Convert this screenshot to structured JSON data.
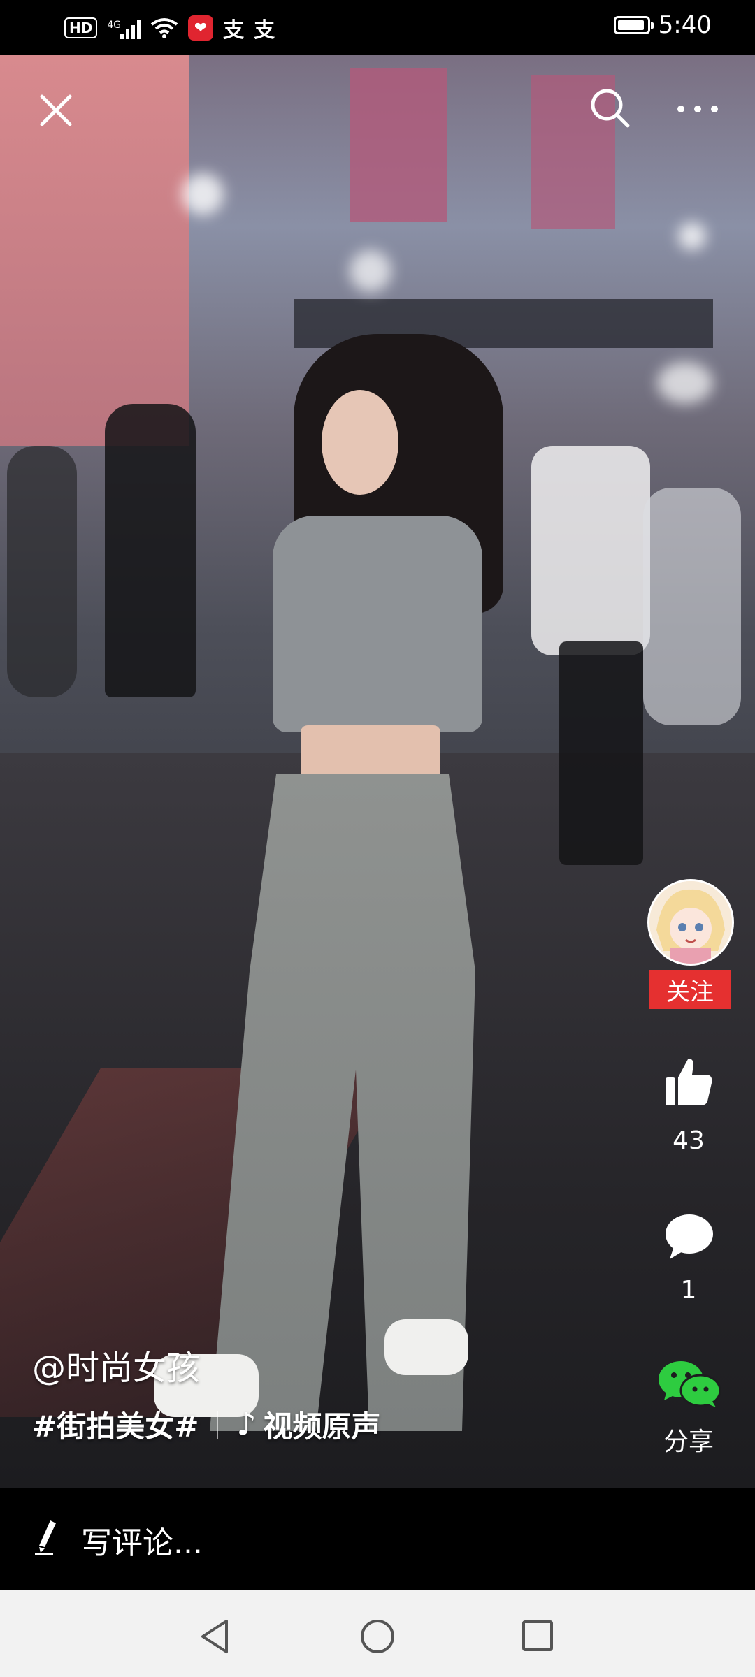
{
  "status_bar": {
    "hd": "HD",
    "network": "4G",
    "app_icon_glyph": "❤",
    "pay_icons": [
      "支",
      "支"
    ],
    "time": "5:40"
  },
  "video_top_bar": {
    "icons": [
      "close-icon",
      "search-icon",
      "more-icon"
    ]
  },
  "side_actions": {
    "follow_label": "关注",
    "like_count": "43",
    "comment_count": "1",
    "share_label": "分享"
  },
  "caption": {
    "author": "@时尚女孩",
    "hashtag": "#街拍美女#",
    "music": "视频原声"
  },
  "comment_bar": {
    "placeholder": "写评论..."
  },
  "nav_bar": {
    "icons": [
      "back-icon",
      "home-icon",
      "recents-icon"
    ]
  },
  "colors": {
    "follow_bg": "#e53030",
    "wechat_green": "#2ecc40",
    "navbar_bg": "#f2f2f2"
  }
}
